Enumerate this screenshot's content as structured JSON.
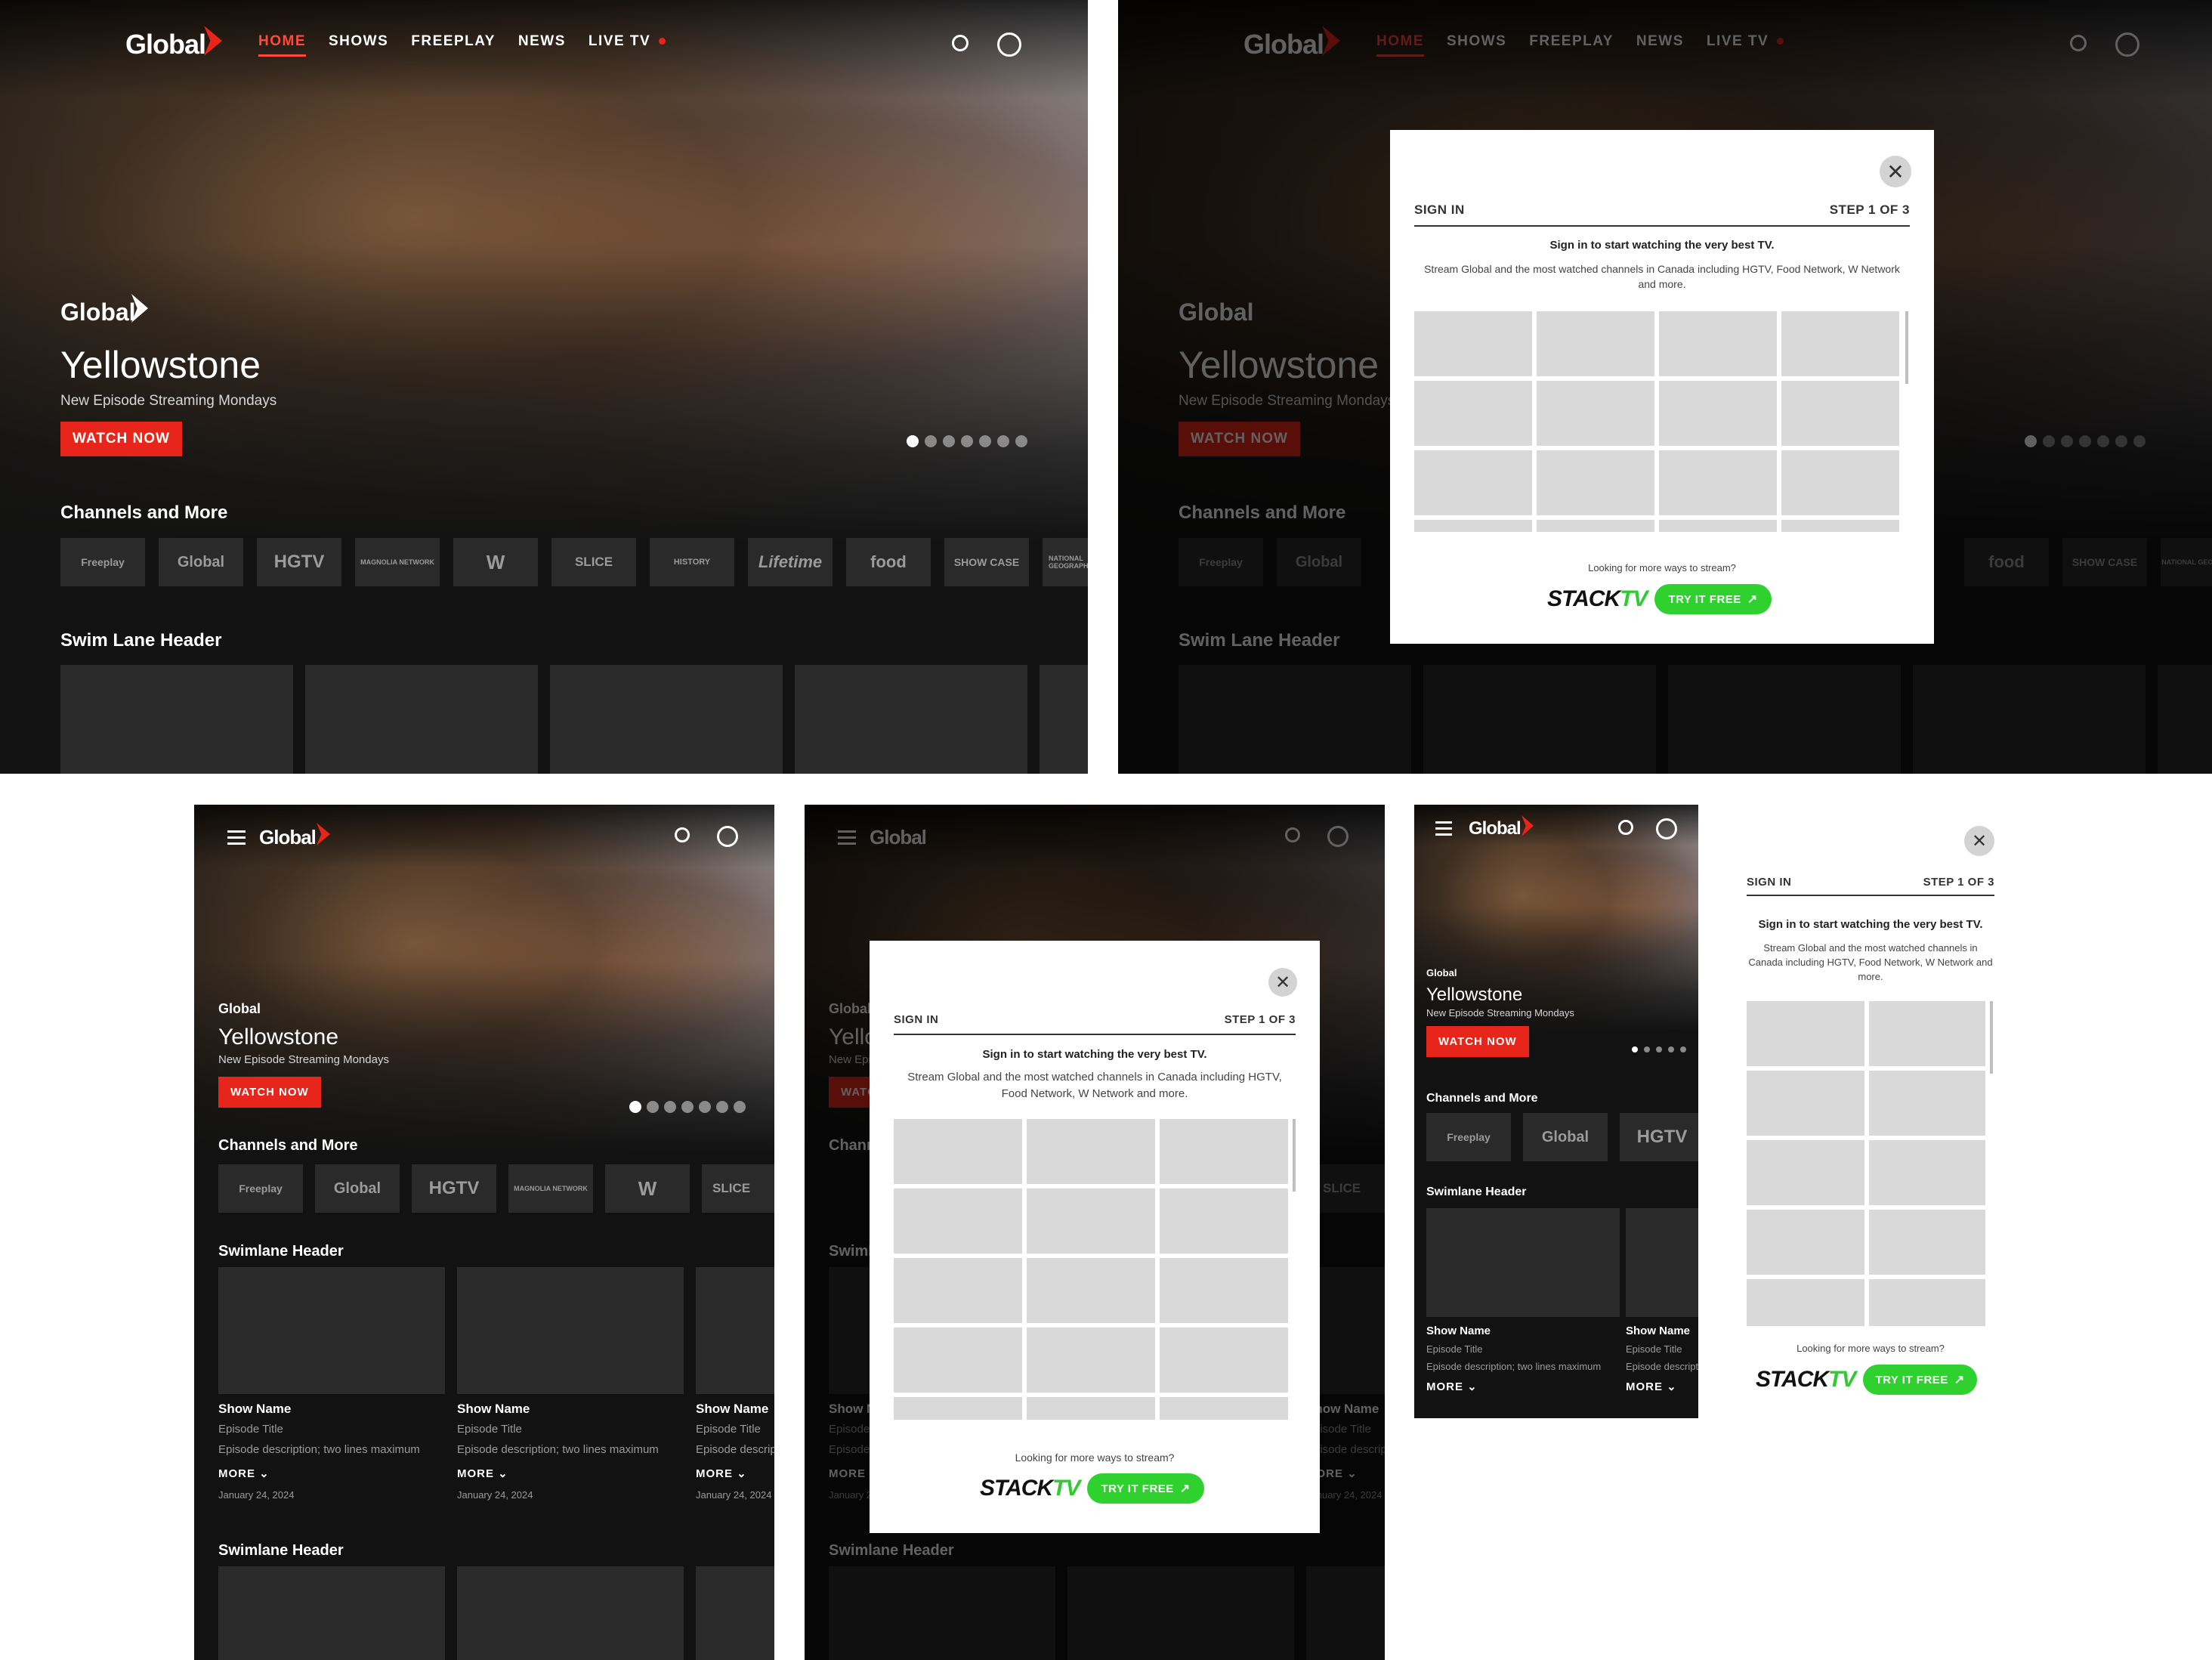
{
  "brand": {
    "logo": "Global",
    "accent": "#e8251a",
    "stack_green": "#2ed12e"
  },
  "nav": {
    "items": [
      "HOME",
      "SHOWS",
      "FREEPLAY",
      "NEWS",
      "LIVE TV"
    ],
    "icons": [
      "search-icon",
      "account-icon",
      "menu-icon"
    ]
  },
  "hero": {
    "network": "Global",
    "title": "Yellowstone",
    "subtitle": "New Episode Streaming Mondays",
    "cta": "WATCH NOW",
    "active_slide": 1
  },
  "channels": {
    "title": "Channels and More",
    "items": [
      "Freeplay",
      "Global",
      "HGTV",
      "MAGNOLIA NETWORK",
      "W",
      "SLICE",
      "HISTORY",
      "Lifetime",
      "food",
      "SHOW CASE",
      "NATIONAL GEOGRAPHIC"
    ]
  },
  "swimlane": {
    "title_desktop": "Swim Lane Header",
    "title_tablet": "Swimlane Header",
    "show_name": "Show Name",
    "episode_title": "Episode Title",
    "description": "Episode description; two lines maximum",
    "more": "MORE",
    "date": "January 24, 2024"
  },
  "modal": {
    "sign_in": "SIGN IN",
    "step": "STEP 1 OF 3",
    "headline": "Sign in to start watching the very best TV.",
    "description": "Stream Global and the most watched channels in Canada including HGTV, Food Network, W Network and more.",
    "looking": "Looking for more ways to stream?",
    "stack_logo_a": "STACK",
    "stack_logo_b": "TV",
    "try": "TRY IT FREE"
  }
}
